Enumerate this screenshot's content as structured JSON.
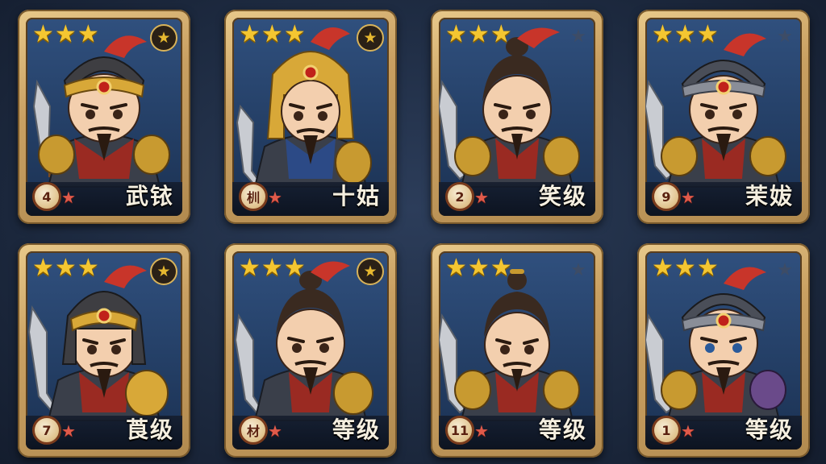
{
  "heroes": [
    {
      "level": "4",
      "name": "武铱",
      "rank_icon": "red-star-icon",
      "stars": 3,
      "badge": "gold"
    },
    {
      "level": "杊",
      "name": "十姑",
      "rank_icon": "red-star-icon",
      "stars": 3,
      "badge": "gold"
    },
    {
      "level": "2",
      "name": "笑级",
      "rank_icon": "red-star-icon",
      "stars": 3,
      "badge": "dim"
    },
    {
      "level": "9",
      "name": "茉妭",
      "rank_icon": "red-star-icon",
      "stars": 3,
      "badge": "dim"
    },
    {
      "level": "7",
      "name": "莨级",
      "rank_icon": "red-star-icon",
      "stars": 3,
      "badge": "gold"
    },
    {
      "level": "材",
      "name": "等级",
      "rank_icon": "red-star-icon",
      "stars": 3,
      "badge": "gold"
    },
    {
      "level": "11",
      "name": "等级",
      "rank_icon": "red-star-icon",
      "stars": 3,
      "badge": "dim"
    },
    {
      "level": "1",
      "name": "等级",
      "rank_icon": "red-star-icon",
      "stars": 3,
      "badge": "dim"
    }
  ],
  "colors": {
    "background": "#1d2a40",
    "card_frame": "#c9a062",
    "card_inner": "#2a4670",
    "star_gold": "#f4c631",
    "rank_star": "#e05a4a",
    "name_text": "#f5efe0"
  }
}
